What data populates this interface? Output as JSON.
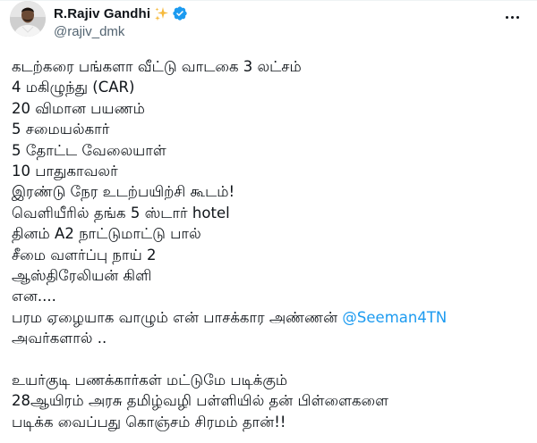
{
  "author": {
    "display_name": "R.Rajiv Gandhi",
    "handle": "@rajiv_dmk",
    "avatar_icon": "avatar-photo",
    "sparkles_icon": "sparkles-icon",
    "verified_icon": "verified-badge-icon"
  },
  "more_icon": "more-options-icon",
  "tweet": {
    "lines": [
      "கடற்கரை பங்களா வீட்டு வாடகை 3 லட்சம்",
      "4 மகிழுந்து (CAR)",
      "20 விமான பயணம்",
      "5 சமையல்கார்",
      "5 தோட்ட வேலையாள்",
      "10 பாதுகாவலர்",
      "இரண்டு நேர உடற்பயிற்சி கூடம்!",
      "வெளியீரில் தங்க 5 ஸ்டார் hotel",
      "தினம் A2 நாட்டுமாட்டு பால்",
      "சீமை வளர்ப்பு நாய் 2",
      "ஆஸ்திரேலியன் கிளி",
      "என....",
      "பரம ஏழையாக வாழும் என் பாசக்கார அண்ணன் "
    ],
    "mention": "@Seeman4TN",
    "after_mention": "அவர்களால் ..",
    "final_lines": [
      "உயர்குடி பணக்கார்கள் மட்டுமே படிக்கும்",
      "28ஆயிரம் அரசு  தமிழ்வழி பள்ளியில் தன் பிள்ளைகளை",
      "படிக்க வைப்பது கொஞ்சம் சிரமம் தான்!!"
    ]
  },
  "colors": {
    "text": "#0f1419",
    "secondary": "#536471",
    "link": "#1d9bf0",
    "verified": "#1d9bf0"
  }
}
